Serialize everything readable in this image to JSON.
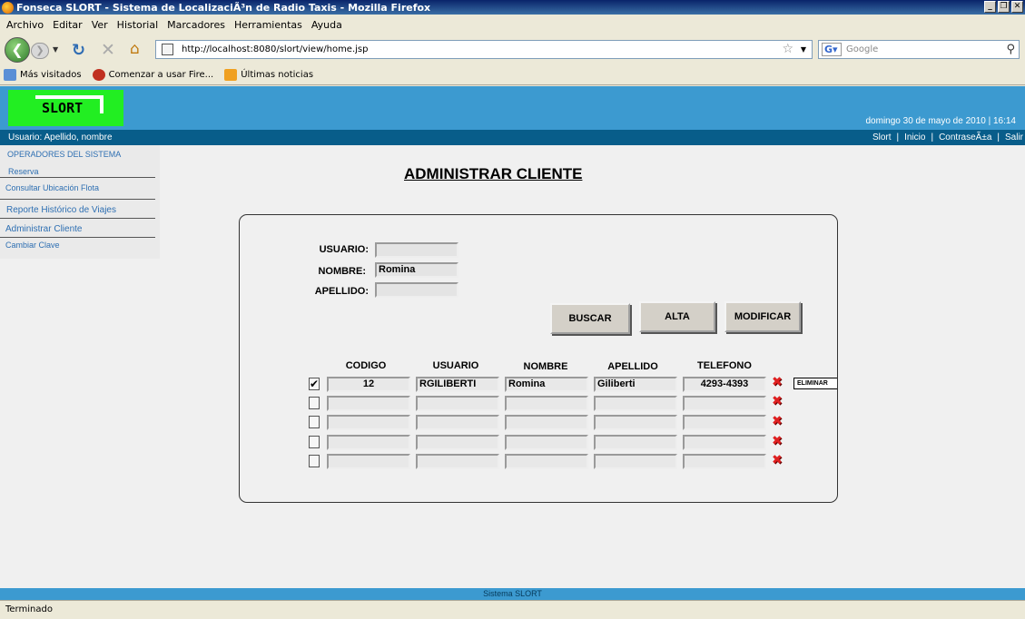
{
  "window": {
    "title": "Fonseca SLORT - Sistema de LocalizaciÃ³n de Radio Taxis - Mozilla Firefox"
  },
  "menu": [
    "Archivo",
    "Editar",
    "Ver",
    "Historial",
    "Marcadores",
    "Herramientas",
    "Ayuda"
  ],
  "nav": {
    "url": "http://localhost:8080/slort/view/home.jsp",
    "search_placeholder": "Google"
  },
  "bookmarks": [
    "Más visitados",
    "Comenzar a usar Fire...",
    "Últimas noticias"
  ],
  "header": {
    "logo": "SLORT",
    "date": "domingo 30 de mayo de 2010 | 16:14"
  },
  "userbar": {
    "user": "Usuario: Apellido, nombre",
    "links": [
      "Slort",
      "|",
      "Inicio",
      "|",
      "ContraseÃ±a",
      "|",
      "Salir"
    ]
  },
  "sidebar": [
    {
      "label": "OPERADORES DEL SISTEMA"
    },
    {
      "label": "Reserva"
    },
    {
      "label": "Consultar Ubicación Flota"
    },
    {
      "label": "Reporte Histórico de Viajes"
    },
    {
      "label": "Administrar Cliente"
    },
    {
      "label": "Cambiar Clave"
    }
  ],
  "main": {
    "title": "ADMINISTRAR CLIENTE",
    "form": {
      "usuario_label": "USUARIO:",
      "usuario_value": "",
      "nombre_label": "NOMBRE:",
      "nombre_value": "Romina",
      "apellido_label": "APELLIDO:",
      "apellido_value": ""
    },
    "buttons": {
      "buscar": "BUSCAR",
      "alta": "ALTA",
      "modificar": "MODIFICAR"
    },
    "columns": [
      "CODIGO",
      "USUARIO",
      "NOMBRE",
      "APELLIDO",
      "TELEFONO"
    ],
    "rows": [
      {
        "checked": "✔",
        "codigo": "12",
        "usuario": "RGILIBERTI",
        "nombre": "Romina",
        "apellido": "Giliberti",
        "telefono": "4293-4393"
      },
      {
        "checked": "",
        "codigo": "",
        "usuario": "",
        "nombre": "",
        "apellido": "",
        "telefono": ""
      },
      {
        "checked": "",
        "codigo": "",
        "usuario": "",
        "nombre": "",
        "apellido": "",
        "telefono": ""
      },
      {
        "checked": "",
        "codigo": "",
        "usuario": "",
        "nombre": "",
        "apellido": "",
        "telefono": ""
      },
      {
        "checked": "",
        "codigo": "",
        "usuario": "",
        "nombre": "",
        "apellido": "",
        "telefono": ""
      }
    ],
    "eliminar": "ELIMINAR"
  },
  "footer": "Sistema SLORT",
  "status": "Terminado",
  "icons": {
    "delete": "delete-x-icon",
    "back": "back-arrow-icon"
  },
  "colors": {
    "header": "#3c9ad0",
    "userbar": "#085d8a",
    "logo": "#22ee22"
  }
}
